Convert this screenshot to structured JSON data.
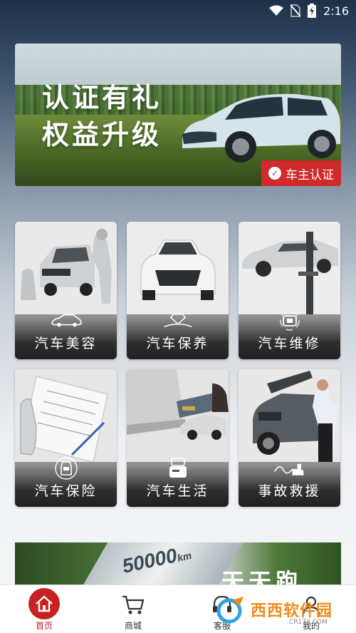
{
  "status_bar": {
    "time": "2:16",
    "icons": [
      "wifi-icon",
      "no-sim-icon",
      "battery-charging-icon"
    ]
  },
  "banner": {
    "headline_line1": "认证有礼",
    "headline_line2": "权益升级",
    "badge_label": "车主认证",
    "colors": {
      "badge": "#d02a2a"
    }
  },
  "services": [
    {
      "label": "汽车美容",
      "icon": "car-icon"
    },
    {
      "label": "汽车保养",
      "icon": "diamond-icon"
    },
    {
      "label": "汽车维修",
      "icon": "repair-icon"
    },
    {
      "label": "汽车保险",
      "icon": "car-shield-icon"
    },
    {
      "label": "汽车生活",
      "icon": "card-icon"
    },
    {
      "label": "事故救援",
      "icon": "tow-hook-icon"
    }
  ],
  "promo": {
    "km_text": "50000",
    "km_unit": "km",
    "slogan": "天天跑"
  },
  "tabbar": {
    "items": [
      {
        "label": "首页",
        "icon": "home-icon",
        "active": true
      },
      {
        "label": "商城",
        "icon": "cart-icon",
        "active": false
      },
      {
        "label": "客服",
        "icon": "headset-icon",
        "active": false
      },
      {
        "label": "我的",
        "icon": "user-icon",
        "active": false
      }
    ],
    "colors": {
      "active": "#c8211f"
    }
  },
  "watermark": {
    "text": "西西软件园",
    "sub": "CR173.COM"
  }
}
